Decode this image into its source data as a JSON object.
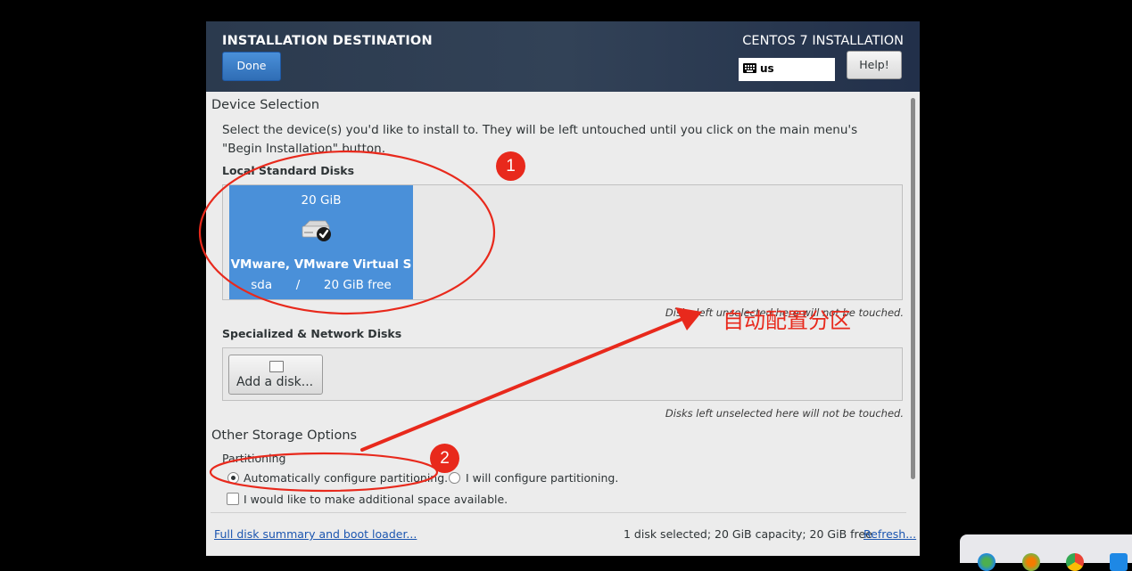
{
  "header": {
    "title": "INSTALLATION DESTINATION",
    "product": "CENTOS 7 INSTALLATION",
    "done_label": "Done",
    "keyboard_layout": "us",
    "help_label": "Help!"
  },
  "device_selection": {
    "title": "Device Selection",
    "description_line1": "Select the device(s) you'd like to install to.  They will be left untouched until you click on the main menu's",
    "description_line2": "\"Begin Installation\" button.",
    "local_disks_label": "Local Standard Disks",
    "disk": {
      "size": "20 GiB",
      "name": "VMware, VMware Virtual S",
      "device": "sda",
      "separator": "/",
      "free": "20 GiB free",
      "selected": true
    },
    "local_note": "Disks left unselected here will not be touched.",
    "specialized_label": "Specialized & Network Disks",
    "add_disk_label": "Add a disk...",
    "specialized_note": "Disks left unselected here will not be touched."
  },
  "other_storage": {
    "title": "Other Storage Options",
    "partitioning_label": "Partitioning",
    "auto_label": "Automatically configure partitioning.",
    "manual_label": "I will configure partitioning.",
    "selected": "auto",
    "extra_space_label": "I would like to make additional space available.",
    "extra_space_checked": false
  },
  "footer": {
    "summary_link": "Full disk summary and boot loader...",
    "status": "1 disk selected; 20 GiB capacity; 20 GiB free",
    "refresh_link": "Refresh..."
  },
  "annotations": {
    "badge1": "1",
    "badge2": "2",
    "note": "自动配置分区",
    "color": "#e8291c"
  }
}
